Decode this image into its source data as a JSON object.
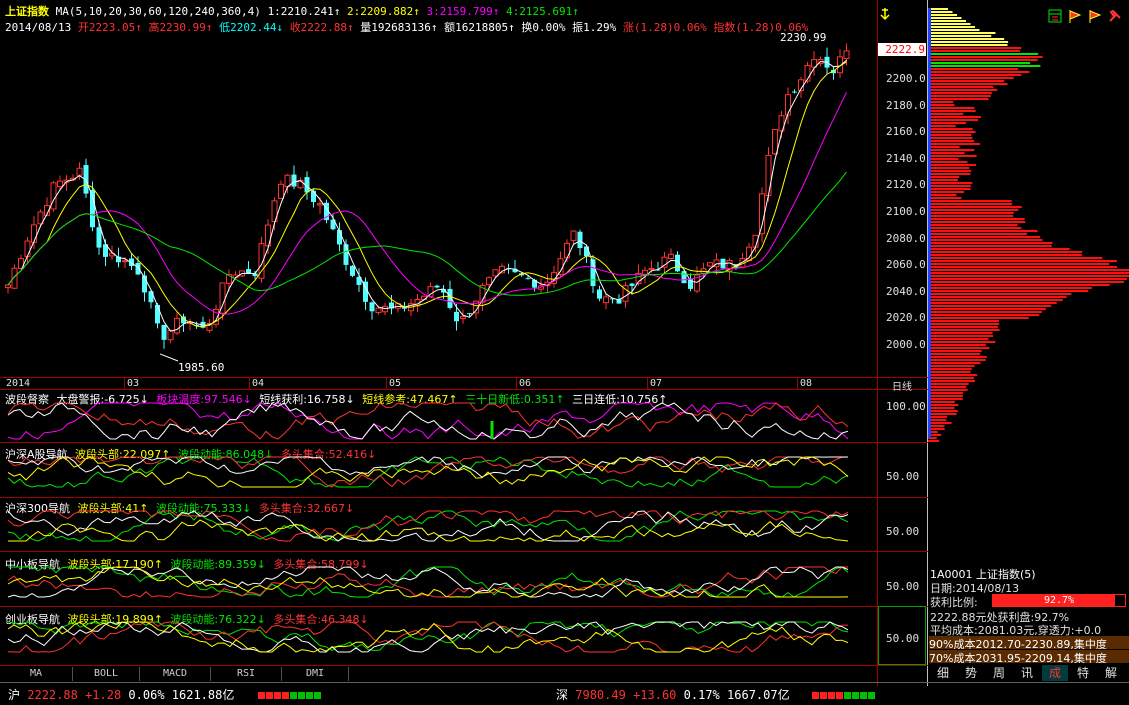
{
  "header": {
    "title": "上证指数",
    "ma_label": "MA(5,10,20,30,60,120,240,360,4)",
    "ma1": "1:2210.241↑",
    "ma2": "2:2209.882↑",
    "ma3": "3:2159.799↑",
    "ma4": "4:2125.691↑",
    "date": "2014/08/13",
    "open": "开2223.05↑",
    "high": "高2230.99↑",
    "low": "低2202.44↓",
    "close": "收2222.88↑",
    "volume": "量192683136↑",
    "amount": "额16218805↑",
    "turnover": "换0.00%",
    "amplitude": "振1.29%",
    "change": "涨(1.28)0.06%",
    "index": "指数(1.28)0.06%"
  },
  "main_chart": {
    "y_ticks": [
      "2200.0",
      "2180.0",
      "2160.0",
      "2140.0",
      "2120.0",
      "2100.0",
      "2080.0",
      "2060.0",
      "2040.0",
      "2020.0",
      "2000.0"
    ],
    "price_tag": "2222.9",
    "high_label": "2230.99",
    "low_label": "1985.60",
    "months": [
      "2014",
      "03",
      "04",
      "05",
      "06",
      "07",
      "08"
    ],
    "period": "日线",
    "colors": {
      "up": "#ff3232",
      "down": "#54ffff",
      "ma5": "#ffffff",
      "ma10": "#ffff00",
      "ma20": "#ff00ff",
      "ma30": "#00e600"
    }
  },
  "panels": [
    {
      "name": "波段督察",
      "items": [
        {
          "label": "大盘警报:-6.725↓",
          "color": "white"
        },
        {
          "label": "板块温度:97.546↓",
          "color": "mag"
        },
        {
          "label": "短线获利:16.758↓",
          "color": "white"
        },
        {
          "label": "短线参考:47.467↑",
          "color": "yellow"
        },
        {
          "label": "三十日新低:0.351↑",
          "color": "green"
        },
        {
          "label": "三日连低:10.756↑",
          "color": "white"
        }
      ],
      "tick": "100.00"
    },
    {
      "name": "沪深A股导航",
      "items": [
        {
          "label": "波段头部:22.097↑",
          "color": "yellow"
        },
        {
          "label": "波段动能:86.048↓",
          "color": "green"
        },
        {
          "label": "多头集合:52.416↓",
          "color": "red"
        }
      ],
      "tick": "50.00"
    },
    {
      "name": "沪深300导航",
      "items": [
        {
          "label": "波段头部:41↑",
          "color": "yellow"
        },
        {
          "label": "波段动能:75.333↓",
          "color": "green"
        },
        {
          "label": "多头集合:32.667↓",
          "color": "red"
        }
      ],
      "tick": "50.00"
    },
    {
      "name": "中小板导航",
      "items": [
        {
          "label": "波段头部:17.190↑",
          "color": "yellow"
        },
        {
          "label": "波段动能:89.359↓",
          "color": "green"
        },
        {
          "label": "多头集合:58.799↓",
          "color": "red"
        }
      ],
      "tick": "50.00"
    },
    {
      "name": "创业板导航",
      "items": [
        {
          "label": "波段头部:19.899↑",
          "color": "yellow"
        },
        {
          "label": "波段动能:76.322↓",
          "color": "green"
        },
        {
          "label": "多头集合:46.348↓",
          "color": "red"
        }
      ],
      "tick": "50.00"
    }
  ],
  "bottom_tabs": [
    "MA",
    "BOLL",
    "MACD",
    "RSI",
    "DMI"
  ],
  "right_panel": {
    "code": "1A0001 上证指数(5)",
    "date": "日期:2014/08/13",
    "profit_label": "获利比例:",
    "profit_value": "92.7%",
    "profit_fraction": 0.927,
    "line1": "2222.88元处获利盘:92.7%",
    "line2": "平均成本:2081.03元,穿透力:+0.0",
    "line3": "90%成本2012.70-2230.89,集中度",
    "line4": "70%成本2031.95-2209.14,集中度",
    "tabs": [
      "细",
      "势",
      "周",
      "讯",
      "成",
      "特",
      "解"
    ],
    "active_tab": "成"
  },
  "status_bar": {
    "sh_label": "沪",
    "sh_value": "2222.88",
    "sh_change": "+1.28",
    "sh_pct": "0.06%",
    "sh_amount": "1621.88亿",
    "sz_label": "深",
    "sz_value": "7980.49",
    "sz_change": "+13.60",
    "sz_pct": "0.17%",
    "sz_amount": "1667.07亿"
  },
  "toolbar_icons": [
    "window-icon",
    "flag-icon",
    "flag-icon",
    "tools-icon"
  ]
}
